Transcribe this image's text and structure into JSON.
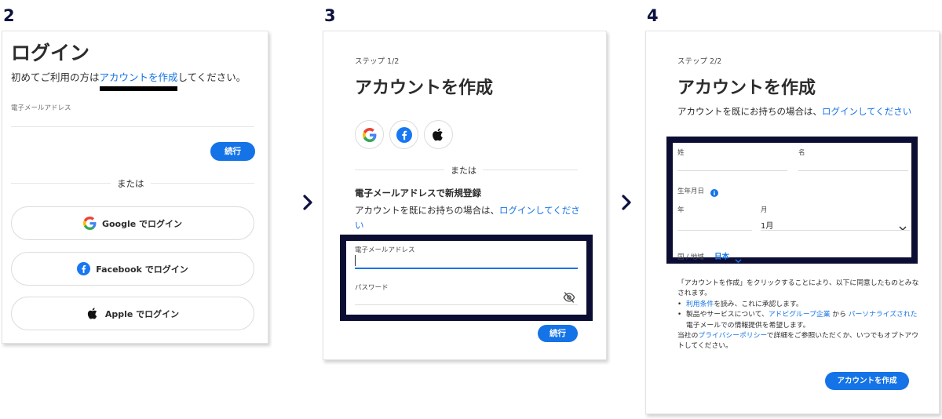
{
  "steps": {
    "two": "2",
    "three": "3",
    "four": "4"
  },
  "login": {
    "title": "ログイン",
    "intro_before": "初めてご利用の方は",
    "intro_link": "アカウントを作成",
    "intro_after": "してください。",
    "email_label": "電子メールアドレス",
    "continue_label": "続行",
    "or_label": "または",
    "google_label": "Google でログイン",
    "facebook_label": "Facebook でログイン",
    "apple_label": "Apple でログイン"
  },
  "signup_step1": {
    "step_label": "ステップ 1/2",
    "title": "アカウントを作成",
    "or_label": "または",
    "email_signup_heading": "電子メールアドレスで新規登録",
    "have_account_text": "アカウントを既にお持ちの場合は、",
    "have_account_link": "ログインしてください",
    "email_label": "電子メールアドレス",
    "password_label": "パスワード",
    "continue_label": "続行"
  },
  "signup_step2": {
    "step_label": "ステップ 2/2",
    "title": "アカウントを作成",
    "have_account_text": "アカウントを既にお持ちの場合は、",
    "have_account_link": "ログインしてください",
    "last_name_label": "姓",
    "first_name_label": "名",
    "dob_label": "生年月日",
    "year_label": "年",
    "month_label": "月",
    "month_value": "1月",
    "country_label": "国 / 地域",
    "country_value": "日本",
    "terms_intro": "「アカウントを作成」をクリックすることにより、以下に同意したものとみなされます。",
    "terms_item1_link": "利用条件",
    "terms_item1_text": "を読み、これに承認します。",
    "terms_item2_text1": "製品やサービスについて、",
    "terms_item2_link1": "アドビグループ企業",
    "terms_item2_text2": " から ",
    "terms_item2_link2": "パーソナライズされた",
    "terms_item2_text3": " 電子メールでの情報提供を希望します。",
    "privacy_text1": "当社の",
    "privacy_link": "プライバシーポリシー",
    "privacy_text2": "で詳細をご参照いただくか、いつでもオプトアウトしてください。",
    "create_label": "アカウントを作成"
  },
  "colors": {
    "accent": "#1473e6",
    "frame": "#0c0d33",
    "step_number": "#0c1140"
  },
  "icons": [
    "google-icon",
    "facebook-icon",
    "apple-icon",
    "eye-off-icon",
    "info-icon",
    "chevron-down-icon",
    "chevron-right-icon"
  ]
}
